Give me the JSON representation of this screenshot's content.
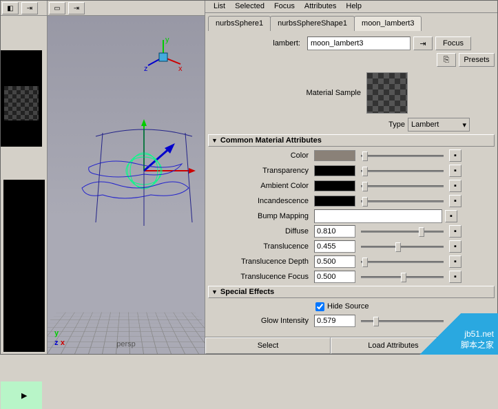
{
  "menu": [
    "List",
    "Selected",
    "Focus",
    "Attributes",
    "Help"
  ],
  "tabs": [
    {
      "label": "nurbsSphere1",
      "active": false
    },
    {
      "label": "nurbsSphereShape1",
      "active": false
    },
    {
      "label": "moon_lambert3",
      "active": true
    }
  ],
  "nodeType": "lambert:",
  "nodeName": "moon_lambert3",
  "btnFocus": "Focus",
  "btnPresets": "Presets",
  "sampleLabel": "Material Sample",
  "typeLabel": "Type",
  "typeValue": "Lambert",
  "sectionCommon": "Common Material Attributes",
  "sectionSpecial": "Special Effects",
  "attrs": {
    "color": {
      "label": "Color",
      "swatch": "#8a8178"
    },
    "transparency": {
      "label": "Transparency",
      "swatch": "#000000"
    },
    "ambient": {
      "label": "Ambient Color",
      "swatch": "#000000"
    },
    "incand": {
      "label": "Incandescence",
      "swatch": "#000000"
    },
    "bump": {
      "label": "Bump Mapping"
    },
    "diffuse": {
      "label": "Diffuse",
      "value": "0.810",
      "pos": 70
    },
    "translucence": {
      "label": "Translucence",
      "value": "0.455",
      "pos": 42
    },
    "translDepth": {
      "label": "Translucence Depth",
      "value": "0.500",
      "pos": 2
    },
    "translFocus": {
      "label": "Translucence Focus",
      "value": "0.500",
      "pos": 48
    },
    "hideSource": {
      "label": "Hide Source",
      "checked": true
    },
    "glowIntensity": {
      "label": "Glow Intensity",
      "value": "0.579",
      "pos": 15
    }
  },
  "footer": {
    "select": "Select",
    "load": "Load Attributes"
  },
  "viewport": {
    "camera": "persp",
    "axes": {
      "x": "x",
      "y": "y",
      "z": "z"
    }
  },
  "watermark": {
    "url": "jb51.net",
    "name": "脚本之家"
  },
  "icons": {
    "play": "▶",
    "tri": "▼",
    "map": "▪",
    "chev": "▾",
    "pin": "⇥",
    "copy": "⎘"
  }
}
